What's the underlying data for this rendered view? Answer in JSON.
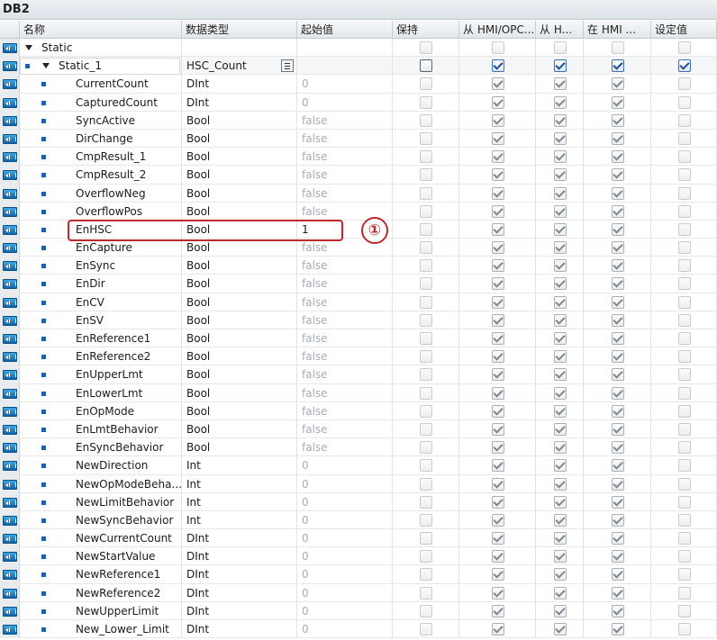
{
  "window": {
    "title": "DB2"
  },
  "columns": {
    "name": "名称",
    "data_type": "数据类型",
    "start_value": "起始值",
    "retain": "保持",
    "from_hmi_opc": "从 HMI/OPC...",
    "from_h": "从 H...",
    "in_hmi": "在 HMI ...",
    "setpoint": "设定值"
  },
  "annotation": {
    "marker": "①"
  },
  "rows": [
    {
      "level": 0,
      "name": "Static",
      "type": "",
      "start": "",
      "expand": true,
      "flags": [
        0,
        0,
        0,
        0,
        0
      ]
    },
    {
      "level": 1,
      "name": "Static_1",
      "type": "HSC_Count",
      "start": "",
      "expand": true,
      "selected": true,
      "flags": [
        2,
        3,
        3,
        3,
        3
      ]
    },
    {
      "level": 2,
      "name": "CurrentCount",
      "type": "DInt",
      "start": "0",
      "flags": [
        0,
        1,
        1,
        1,
        0
      ]
    },
    {
      "level": 2,
      "name": "CapturedCount",
      "type": "DInt",
      "start": "0",
      "flags": [
        0,
        1,
        1,
        1,
        0
      ]
    },
    {
      "level": 2,
      "name": "SyncActive",
      "type": "Bool",
      "start": "false",
      "flags": [
        0,
        1,
        1,
        1,
        0
      ]
    },
    {
      "level": 2,
      "name": "DirChange",
      "type": "Bool",
      "start": "false",
      "flags": [
        0,
        1,
        1,
        1,
        0
      ]
    },
    {
      "level": 2,
      "name": "CmpResult_1",
      "type": "Bool",
      "start": "false",
      "flags": [
        0,
        1,
        1,
        1,
        0
      ]
    },
    {
      "level": 2,
      "name": "CmpResult_2",
      "type": "Bool",
      "start": "false",
      "flags": [
        0,
        1,
        1,
        1,
        0
      ]
    },
    {
      "level": 2,
      "name": "OverflowNeg",
      "type": "Bool",
      "start": "false",
      "flags": [
        0,
        1,
        1,
        1,
        0
      ]
    },
    {
      "level": 2,
      "name": "OverflowPos",
      "type": "Bool",
      "start": "false",
      "flags": [
        0,
        1,
        1,
        1,
        0
      ]
    },
    {
      "level": 2,
      "name": "EnHSC",
      "type": "Bool",
      "start": "1",
      "edited": true,
      "flags": [
        0,
        1,
        1,
        1,
        0
      ]
    },
    {
      "level": 2,
      "name": "EnCapture",
      "type": "Bool",
      "start": "false",
      "flags": [
        0,
        1,
        1,
        1,
        0
      ]
    },
    {
      "level": 2,
      "name": "EnSync",
      "type": "Bool",
      "start": "false",
      "flags": [
        0,
        1,
        1,
        1,
        0
      ]
    },
    {
      "level": 2,
      "name": "EnDir",
      "type": "Bool",
      "start": "false",
      "flags": [
        0,
        1,
        1,
        1,
        0
      ]
    },
    {
      "level": 2,
      "name": "EnCV",
      "type": "Bool",
      "start": "false",
      "flags": [
        0,
        1,
        1,
        1,
        0
      ]
    },
    {
      "level": 2,
      "name": "EnSV",
      "type": "Bool",
      "start": "false",
      "flags": [
        0,
        1,
        1,
        1,
        0
      ]
    },
    {
      "level": 2,
      "name": "EnReference1",
      "type": "Bool",
      "start": "false",
      "flags": [
        0,
        1,
        1,
        1,
        0
      ]
    },
    {
      "level": 2,
      "name": "EnReference2",
      "type": "Bool",
      "start": "false",
      "flags": [
        0,
        1,
        1,
        1,
        0
      ]
    },
    {
      "level": 2,
      "name": "EnUpperLmt",
      "type": "Bool",
      "start": "false",
      "flags": [
        0,
        1,
        1,
        1,
        0
      ]
    },
    {
      "level": 2,
      "name": "EnLowerLmt",
      "type": "Bool",
      "start": "false",
      "flags": [
        0,
        1,
        1,
        1,
        0
      ]
    },
    {
      "level": 2,
      "name": "EnOpMode",
      "type": "Bool",
      "start": "false",
      "flags": [
        0,
        1,
        1,
        1,
        0
      ]
    },
    {
      "level": 2,
      "name": "EnLmtBehavior",
      "type": "Bool",
      "start": "false",
      "flags": [
        0,
        1,
        1,
        1,
        0
      ]
    },
    {
      "level": 2,
      "name": "EnSyncBehavior",
      "type": "Bool",
      "start": "false",
      "flags": [
        0,
        1,
        1,
        1,
        0
      ]
    },
    {
      "level": 2,
      "name": "NewDirection",
      "type": "Int",
      "start": "0",
      "flags": [
        0,
        1,
        1,
        1,
        0
      ]
    },
    {
      "level": 2,
      "name": "NewOpModeBeha...",
      "type": "Int",
      "start": "0",
      "flags": [
        0,
        1,
        1,
        1,
        0
      ]
    },
    {
      "level": 2,
      "name": "NewLimitBehavior",
      "type": "Int",
      "start": "0",
      "flags": [
        0,
        1,
        1,
        1,
        0
      ]
    },
    {
      "level": 2,
      "name": "NewSyncBehavior",
      "type": "Int",
      "start": "0",
      "flags": [
        0,
        1,
        1,
        1,
        0
      ]
    },
    {
      "level": 2,
      "name": "NewCurrentCount",
      "type": "DInt",
      "start": "0",
      "flags": [
        0,
        1,
        1,
        1,
        0
      ]
    },
    {
      "level": 2,
      "name": "NewStartValue",
      "type": "DInt",
      "start": "0",
      "flags": [
        0,
        1,
        1,
        1,
        0
      ]
    },
    {
      "level": 2,
      "name": "NewReference1",
      "type": "DInt",
      "start": "0",
      "flags": [
        0,
        1,
        1,
        1,
        0
      ]
    },
    {
      "level": 2,
      "name": "NewReference2",
      "type": "DInt",
      "start": "0",
      "flags": [
        0,
        1,
        1,
        1,
        0
      ]
    },
    {
      "level": 2,
      "name": "NewUpperLimit",
      "type": "DInt",
      "start": "0",
      "flags": [
        0,
        1,
        1,
        1,
        0
      ]
    },
    {
      "level": 2,
      "name": "New_Lower_Limit",
      "type": "DInt",
      "start": "0",
      "flags": [
        0,
        1,
        1,
        1,
        0
      ]
    }
  ]
}
